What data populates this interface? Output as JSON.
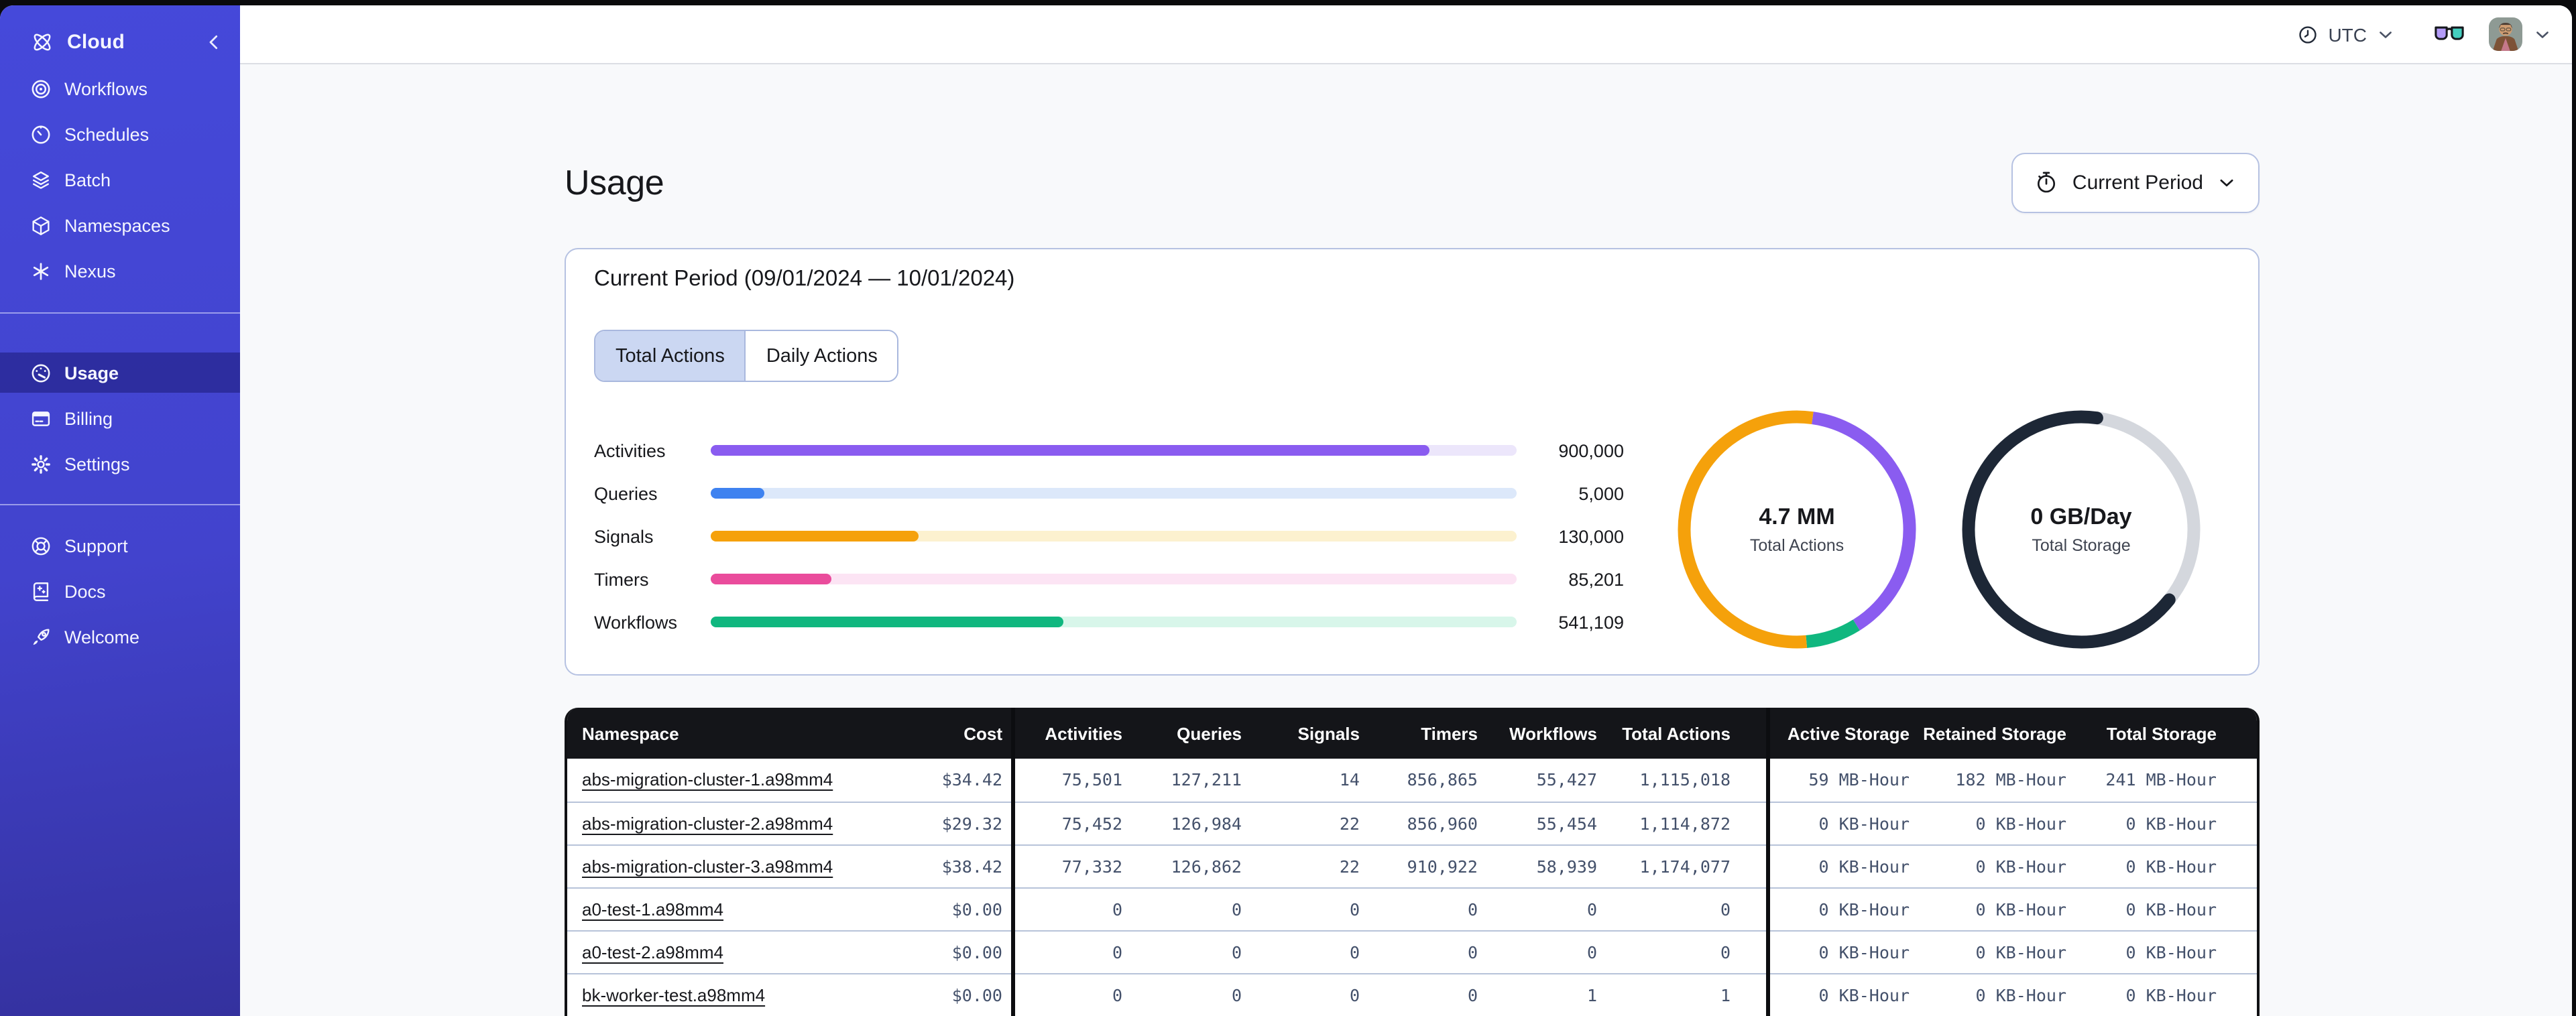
{
  "sidebar": {
    "brand": {
      "label": "Cloud",
      "icon": "temporal-cloud"
    },
    "sections": [
      {
        "items": [
          {
            "icon": "workflows",
            "label": "Workflows",
            "selected": false
          },
          {
            "icon": "schedules",
            "label": "Schedules",
            "selected": false
          },
          {
            "icon": "batch",
            "label": "Batch",
            "selected": false
          },
          {
            "icon": "namespaces",
            "label": "Namespaces",
            "selected": false
          },
          {
            "icon": "nexus",
            "label": "Nexus",
            "selected": false
          }
        ]
      },
      {
        "items": [
          {
            "icon": "usage",
            "label": "Usage",
            "selected": true
          },
          {
            "icon": "billing",
            "label": "Billing",
            "selected": false
          },
          {
            "icon": "settings",
            "label": "Settings",
            "selected": false
          }
        ]
      },
      {
        "items": [
          {
            "icon": "support",
            "label": "Support",
            "selected": false
          },
          {
            "icon": "docs",
            "label": "Docs",
            "selected": false
          },
          {
            "icon": "welcome",
            "label": "Welcome",
            "selected": false
          }
        ]
      }
    ]
  },
  "header": {
    "timezone": "UTC"
  },
  "page": {
    "title": "Usage",
    "period_button_label": "Current Period"
  },
  "usage_card": {
    "title": "Current Period (09/01/2024 — 10/01/2024)",
    "tabs": [
      {
        "label": "Total Actions",
        "selected": true
      },
      {
        "label": "Daily Actions",
        "selected": false
      }
    ],
    "bars": [
      {
        "label": "Activities",
        "value": "900,000",
        "pct": 89.2,
        "color": "#8a5cf0",
        "track": "#ece6fb"
      },
      {
        "label": "Queries",
        "value": "5,000",
        "pct": 6.6,
        "color": "#3e82f0",
        "track": "#dce8fa"
      },
      {
        "label": "Signals",
        "value": "130,000",
        "pct": 25.8,
        "color": "#f5a10b",
        "track": "#fcf1cf"
      },
      {
        "label": "Timers",
        "value": "85,201",
        "pct": 15.0,
        "color": "#ea4c9c",
        "track": "#fce4f4"
      },
      {
        "label": "Workflows",
        "value": "541,109",
        "pct": 43.8,
        "color": "#10b77f",
        "track": "#d8f6ea"
      }
    ],
    "donuts": [
      {
        "value": "4.7 MM",
        "label": "Total Actions",
        "start_deg": 8,
        "segments": [
          {
            "name": "activities",
            "color": "#8a5cf0",
            "frac": 0.389
          },
          {
            "name": "workflows",
            "color": "#10b77f",
            "frac": 0.075
          },
          {
            "name": "signals-other",
            "color": "#f5a10b",
            "frac": 0.536
          }
        ]
      },
      {
        "value": "0 GB/Day",
        "label": "Total Storage",
        "start_deg": 8,
        "segments": [
          {
            "name": "remaining",
            "color": "#d4d7dd",
            "frac": 0.335
          },
          {
            "name": "used",
            "color": "#1d2736",
            "frac": 0.665,
            "cap": "round"
          }
        ]
      }
    ]
  },
  "table": {
    "columns": [
      {
        "label": "Namespace"
      },
      {
        "label": "Cost"
      },
      {
        "label": "Activities",
        "group_start": true
      },
      {
        "label": "Queries"
      },
      {
        "label": "Signals"
      },
      {
        "label": "Timers"
      },
      {
        "label": "Workflows"
      },
      {
        "label": "Total Actions",
        "pad": "lg"
      },
      {
        "label": "Active Storage",
        "group_start": true
      },
      {
        "label": "Retained Storage"
      },
      {
        "label": "Total Storage",
        "pad": "xl"
      }
    ],
    "rows": [
      {
        "cells": [
          "abs-migration-cluster-1.a98mm4",
          "$34.42",
          "75,501",
          "127,211",
          "14",
          "856,865",
          "55,427",
          "1,115,018",
          "59 MB-Hour",
          "182 MB-Hour",
          "241 MB-Hour"
        ]
      },
      {
        "cells": [
          "abs-migration-cluster-2.a98mm4",
          "$29.32",
          "75,452",
          "126,984",
          "22",
          "856,960",
          "55,454",
          "1,114,872",
          "0 KB-Hour",
          "0 KB-Hour",
          "0 KB-Hour"
        ]
      },
      {
        "cells": [
          "abs-migration-cluster-3.a98mm4",
          "$38.42",
          "77,332",
          "126,862",
          "22",
          "910,922",
          "58,939",
          "1,174,077",
          "0 KB-Hour",
          "0 KB-Hour",
          "0 KB-Hour"
        ]
      },
      {
        "cells": [
          "a0-test-1.a98mm4",
          "$0.00",
          "0",
          "0",
          "0",
          "0",
          "0",
          "0",
          "0 KB-Hour",
          "0 KB-Hour",
          "0 KB-Hour"
        ]
      },
      {
        "cells": [
          "a0-test-2.a98mm4",
          "$0.00",
          "0",
          "0",
          "0",
          "0",
          "0",
          "0",
          "0 KB-Hour",
          "0 KB-Hour",
          "0 KB-Hour"
        ]
      },
      {
        "cells": [
          "bk-worker-test.a98mm4",
          "$0.00",
          "0",
          "0",
          "0",
          "0",
          "1",
          "1",
          "0 KB-Hour",
          "0 KB-Hour",
          "0 KB-Hour"
        ]
      }
    ]
  }
}
